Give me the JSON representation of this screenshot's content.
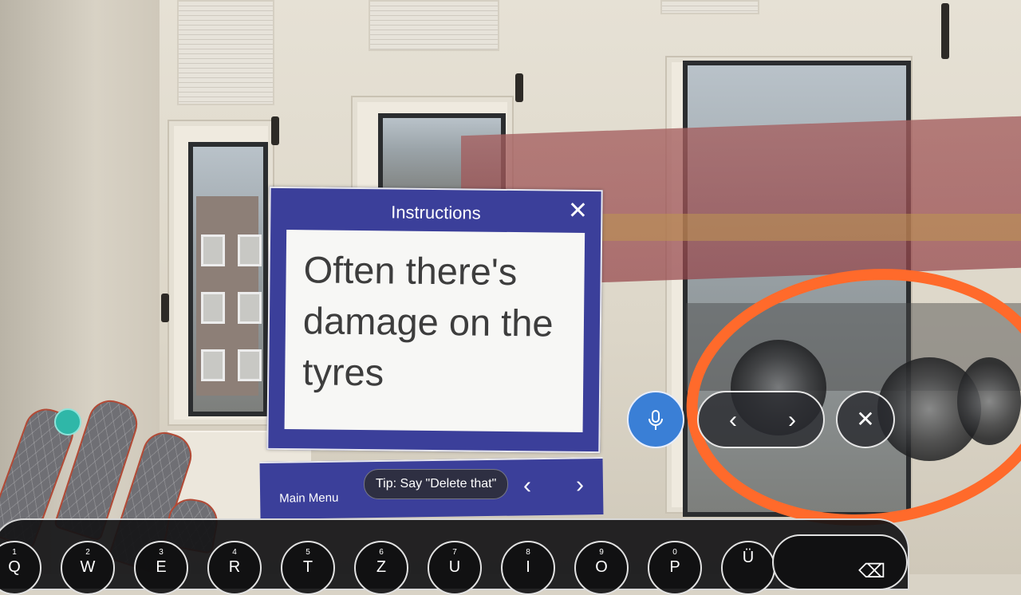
{
  "instructions_panel": {
    "title": "Instructions",
    "close_glyph": "✕",
    "body": "Often there's damage on the tyres"
  },
  "main_menu": {
    "label": "Main Menu",
    "prev_glyph": "‹",
    "next_glyph": "›"
  },
  "tip": {
    "text": "Tip: Say \"Delete that\""
  },
  "controls": {
    "mic_icon": "microphone-icon",
    "prev_glyph": "‹",
    "next_glyph": "›",
    "close_glyph": "✕",
    "mic_color": "#3a7fd6"
  },
  "keyboard": {
    "keys": [
      {
        "num": "1",
        "ch": "Q"
      },
      {
        "num": "2",
        "ch": "W"
      },
      {
        "num": "3",
        "ch": "E"
      },
      {
        "num": "4",
        "ch": "R"
      },
      {
        "num": "5",
        "ch": "T"
      },
      {
        "num": "6",
        "ch": "Z"
      },
      {
        "num": "7",
        "ch": "U"
      },
      {
        "num": "8",
        "ch": "I"
      },
      {
        "num": "9",
        "ch": "O"
      },
      {
        "num": "0",
        "ch": "P"
      },
      {
        "num": "",
        "ch": "Ü"
      }
    ],
    "backspace_glyph": "⌫"
  },
  "colors": {
    "panel_blue": "#3b3f9a",
    "annotation_orange": "#ff6a2b",
    "hand_marker": "#2fb7a8"
  }
}
